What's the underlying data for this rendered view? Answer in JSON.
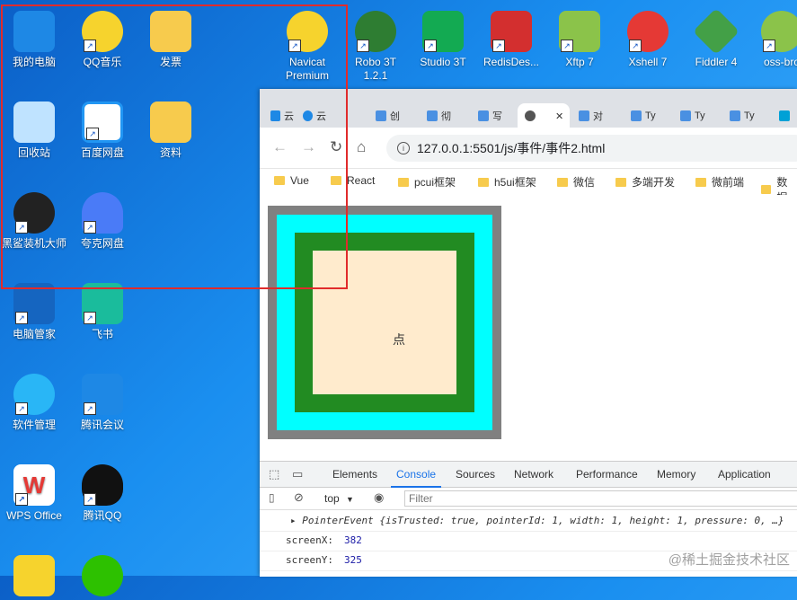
{
  "desktop": {
    "icons": [
      {
        "label": "我的电脑",
        "color": "#1e88e5"
      },
      {
        "label": "QQ音乐",
        "color": "#f6d32d"
      },
      {
        "label": "发票",
        "color": "#f7cb4d"
      },
      {
        "label": "Navicat Premium",
        "color": "#f6d32d"
      },
      {
        "label": "Robo 3T 1.2.1",
        "color": "#2e7d32"
      },
      {
        "label": "Studio 3T",
        "color": "#13aa52"
      },
      {
        "label": "RedisDes...",
        "color": "#d32f2f"
      },
      {
        "label": "Xftp 7",
        "color": "#8bc34a"
      },
      {
        "label": "Xshell 7",
        "color": "#e53935"
      },
      {
        "label": "Fiddler 4",
        "color": "#43a047"
      },
      {
        "label": "oss-bro",
        "color": "#8bc34a"
      },
      {
        "label": "回收站",
        "color": "#bfe3ff"
      },
      {
        "label": "百度网盘",
        "color": "#2196f3"
      },
      {
        "label": "资料",
        "color": "#f7cb4d"
      },
      {
        "label": "黑鲨装机大师",
        "color": "#222222"
      },
      {
        "label": "夸克网盘",
        "color": "#4a7bf7"
      },
      {
        "label": "电脑管家",
        "color": "#1565c0"
      },
      {
        "label": "飞书",
        "color": "#1abc9c"
      },
      {
        "label": "软件管理",
        "color": "#29b6f6"
      },
      {
        "label": "腾讯会议",
        "color": "#1e88e5"
      },
      {
        "label": "WPS Office",
        "color": "#e53935"
      },
      {
        "label": "腾讯QQ",
        "color": "#111111"
      }
    ]
  },
  "browser": {
    "tabs": [
      {
        "label": "云",
        "color": "#1e88e5"
      },
      {
        "label": "云",
        "color": "#1e88e5"
      },
      {
        "label": "创",
        "color": "#4a90e2"
      },
      {
        "label": "彻",
        "color": "#4a90e2"
      },
      {
        "label": "写",
        "color": "#4a90e2"
      },
      {
        "label": "",
        "color": "#555555",
        "active": true,
        "close": "✕"
      },
      {
        "label": "对",
        "color": "#4a90e2"
      },
      {
        "label": "Ty",
        "color": "#4a90e2"
      },
      {
        "label": "Ty",
        "color": "#4a90e2"
      },
      {
        "label": "Ty",
        "color": "#4a90e2"
      }
    ],
    "url": "127.0.0.1:5501/js/事件/事件2.html",
    "bookmarks": [
      "Vue",
      "React",
      "pcui框架",
      "h5ui框架",
      "微信",
      "多端开发",
      "微前端",
      "数据"
    ]
  },
  "page": {
    "cursor_label": "点"
  },
  "devtools": {
    "tabs": [
      "Elements",
      "Console",
      "Sources",
      "Network",
      "Performance",
      "Memory",
      "Application"
    ],
    "active_tab": "Console",
    "context": "top",
    "filter_placeholder": "Filter",
    "console": {
      "event_line": "▸ PointerEvent {isTrusted: true, pointerId: 1, width: 1, height: 1, pressure: 0, …}",
      "rows": [
        {
          "key": "screenX:",
          "value": "382"
        },
        {
          "key": "screenY:",
          "value": "325"
        }
      ]
    }
  },
  "watermark": "@稀土掘金技术社区"
}
